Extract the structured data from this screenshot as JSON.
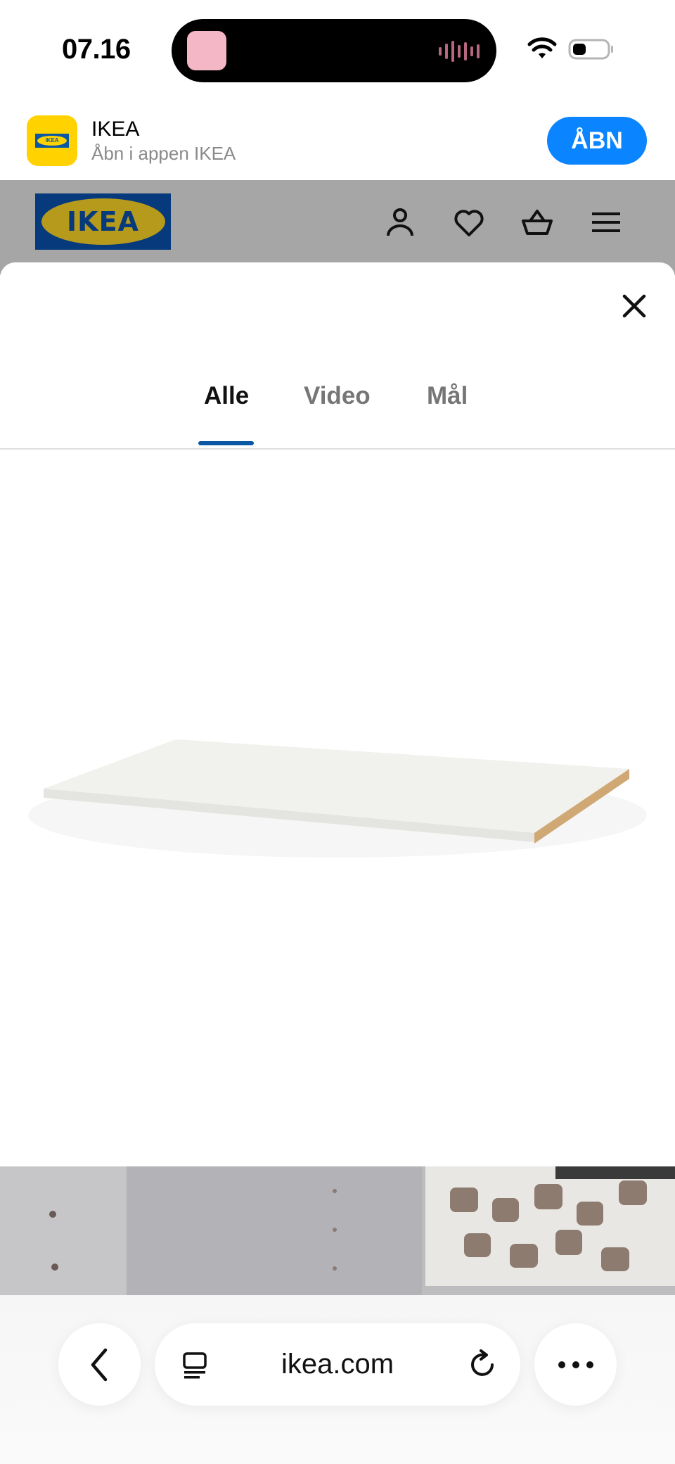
{
  "status_bar": {
    "time": "07.16"
  },
  "app_banner": {
    "app_name": "IKEA",
    "subtitle": "Åbn i appen IKEA",
    "open_label": "ÅBN",
    "icon_text": "IKEA"
  },
  "site_header": {
    "logo_text": "IKEA",
    "icons": [
      "account-icon",
      "heart-icon",
      "basket-icon",
      "menu-icon"
    ]
  },
  "modal": {
    "tabs": [
      {
        "label": "Alle",
        "selected": true
      },
      {
        "label": "Video",
        "selected": false
      },
      {
        "label": "Mål",
        "selected": false
      }
    ]
  },
  "browser": {
    "url": "ikea.com"
  },
  "colors": {
    "accent_blue": "#0a58a3",
    "ios_blue": "#0a84ff",
    "ikea_yellow": "#ffd200",
    "dimmed_header": "#a6a6a6"
  }
}
